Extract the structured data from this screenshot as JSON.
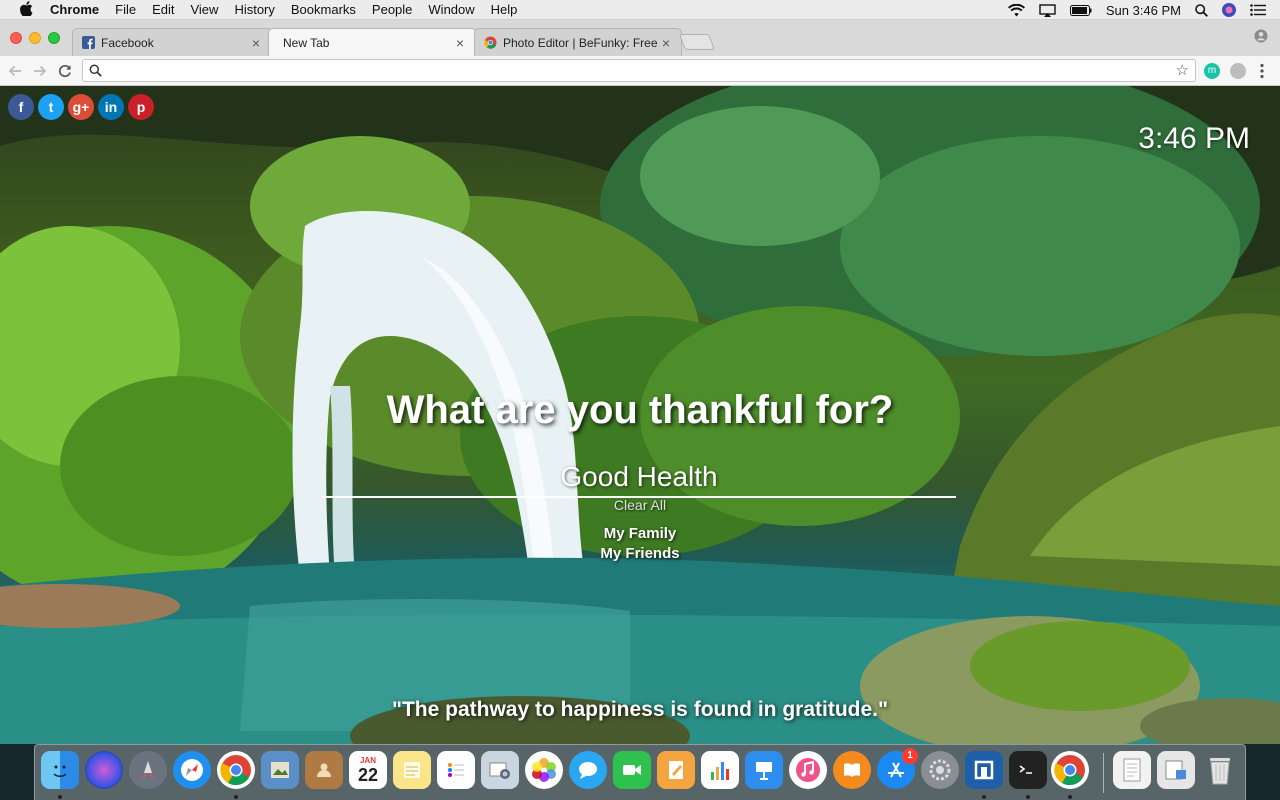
{
  "menubar": {
    "app_name": "Chrome",
    "items": [
      "File",
      "Edit",
      "View",
      "History",
      "Bookmarks",
      "People",
      "Window",
      "Help"
    ],
    "clock": "Sun 3:46 PM"
  },
  "tabs": [
    {
      "title": "Facebook",
      "favicon": "facebook-icon"
    },
    {
      "title": "New Tab",
      "favicon": "none"
    },
    {
      "title": "Photo Editor | BeFunky: Free O",
      "favicon": "chrome-page-icon"
    }
  ],
  "omnibox": {
    "value": "",
    "placeholder": ""
  },
  "extensions": {
    "m_label": "m"
  },
  "social": [
    {
      "name": "facebook",
      "glyph": "f",
      "color": "#3b5998"
    },
    {
      "name": "twitter",
      "glyph": "t",
      "color": "#1da1f2"
    },
    {
      "name": "google-plus",
      "glyph": "g+",
      "color": "#dd4b39"
    },
    {
      "name": "linkedin",
      "glyph": "in",
      "color": "#0077b5"
    },
    {
      "name": "pinterest",
      "glyph": "p",
      "color": "#cb2027"
    }
  ],
  "page": {
    "clock": "3:46 PM",
    "question": "What are you thankful for?",
    "answer_value": "Good Health",
    "clear_all": "Clear All",
    "thankful_items": [
      "My Family",
      "My Friends"
    ],
    "quote": "\"The pathway to happiness is found in gratitude.\""
  },
  "dock": {
    "items": [
      "finder",
      "siri",
      "launchpad",
      "safari",
      "chrome",
      "preview",
      "contacts",
      "calendar",
      "notes",
      "reminders",
      "image-capture",
      "photos",
      "messages",
      "facetime",
      "pages",
      "numbers",
      "keynote",
      "itunes",
      "ibooks",
      "app-store",
      "system-preferences",
      "remote-desktop",
      "terminal",
      "chrome-2",
      "document",
      "preview-2",
      "trash"
    ],
    "calendar_month": "JAN",
    "calendar_day": "22",
    "app_store_badge": "1"
  }
}
